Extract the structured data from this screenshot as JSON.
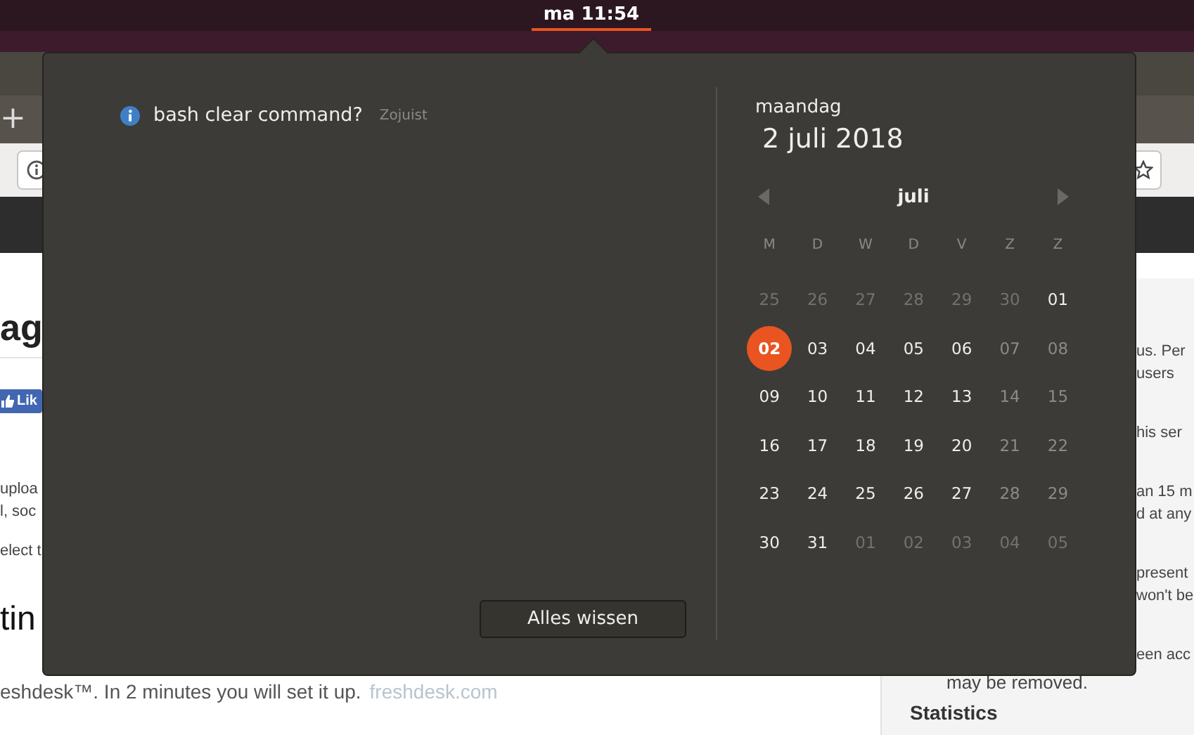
{
  "top_bar": {
    "clock": "ma 11:54"
  },
  "browser": {
    "new_tab": "+"
  },
  "page": {
    "heading": "ag",
    "like_button": "Lik",
    "left_fragments": [
      {
        "lines": [
          "uploa",
          "l, soc"
        ]
      },
      {
        "lines": [
          "elect t"
        ]
      }
    ],
    "section_heading": "tin",
    "footer_text": "eshdesk™. In 2 minutes you will set it up.",
    "footer_link": "freshdesk.com",
    "right_fragments": [
      {
        "lines": [
          "us. Per",
          "users"
        ]
      },
      {
        "lines": [
          "his ser"
        ]
      },
      {
        "lines": [
          "an 15 m",
          "d at any"
        ]
      },
      {
        "lines": [
          "present",
          "won't be"
        ]
      },
      {
        "lines": [
          "een acc"
        ]
      }
    ],
    "list_end": "may be removed.",
    "stats_heading": "Statistics"
  },
  "popup": {
    "notification": {
      "title": "bash clear command?",
      "time": "Zojuist"
    },
    "clear_button": "Alles wissen",
    "calendar": {
      "weekday": "maandag",
      "date": "2 juli 2018",
      "month": "juli",
      "day_headers": [
        "M",
        "D",
        "W",
        "D",
        "V",
        "Z",
        "Z"
      ],
      "weeks": [
        [
          {
            "day": "25",
            "outside_month": true,
            "muted": false,
            "selected": false
          },
          {
            "day": "26",
            "outside_month": true,
            "muted": false,
            "selected": false
          },
          {
            "day": "27",
            "outside_month": true,
            "muted": false,
            "selected": false
          },
          {
            "day": "28",
            "outside_month": true,
            "muted": false,
            "selected": false
          },
          {
            "day": "29",
            "outside_month": true,
            "muted": false,
            "selected": false
          },
          {
            "day": "30",
            "outside_month": true,
            "muted": false,
            "selected": false
          },
          {
            "day": "01",
            "outside_month": false,
            "muted": false,
            "selected": false
          }
        ],
        [
          {
            "day": "02",
            "outside_month": false,
            "muted": false,
            "selected": true
          },
          {
            "day": "03",
            "outside_month": false,
            "muted": false,
            "selected": false
          },
          {
            "day": "04",
            "outside_month": false,
            "muted": false,
            "selected": false
          },
          {
            "day": "05",
            "outside_month": false,
            "muted": false,
            "selected": false
          },
          {
            "day": "06",
            "outside_month": false,
            "muted": false,
            "selected": false
          },
          {
            "day": "07",
            "outside_month": false,
            "muted": true,
            "selected": false
          },
          {
            "day": "08",
            "outside_month": false,
            "muted": true,
            "selected": false
          }
        ],
        [
          {
            "day": "09",
            "outside_month": false,
            "muted": false,
            "selected": false
          },
          {
            "day": "10",
            "outside_month": false,
            "muted": false,
            "selected": false
          },
          {
            "day": "11",
            "outside_month": false,
            "muted": false,
            "selected": false
          },
          {
            "day": "12",
            "outside_month": false,
            "muted": false,
            "selected": false
          },
          {
            "day": "13",
            "outside_month": false,
            "muted": false,
            "selected": false
          },
          {
            "day": "14",
            "outside_month": false,
            "muted": true,
            "selected": false
          },
          {
            "day": "15",
            "outside_month": false,
            "muted": true,
            "selected": false
          }
        ],
        [
          {
            "day": "16",
            "outside_month": false,
            "muted": false,
            "selected": false
          },
          {
            "day": "17",
            "outside_month": false,
            "muted": false,
            "selected": false
          },
          {
            "day": "18",
            "outside_month": false,
            "muted": false,
            "selected": false
          },
          {
            "day": "19",
            "outside_month": false,
            "muted": false,
            "selected": false
          },
          {
            "day": "20",
            "outside_month": false,
            "muted": false,
            "selected": false
          },
          {
            "day": "21",
            "outside_month": false,
            "muted": true,
            "selected": false
          },
          {
            "day": "22",
            "outside_month": false,
            "muted": true,
            "selected": false
          }
        ],
        [
          {
            "day": "23",
            "outside_month": false,
            "muted": false,
            "selected": false
          },
          {
            "day": "24",
            "outside_month": false,
            "muted": false,
            "selected": false
          },
          {
            "day": "25",
            "outside_month": false,
            "muted": false,
            "selected": false
          },
          {
            "day": "26",
            "outside_month": false,
            "muted": false,
            "selected": false
          },
          {
            "day": "27",
            "outside_month": false,
            "muted": false,
            "selected": false
          },
          {
            "day": "28",
            "outside_month": false,
            "muted": true,
            "selected": false
          },
          {
            "day": "29",
            "outside_month": false,
            "muted": true,
            "selected": false
          }
        ],
        [
          {
            "day": "30",
            "outside_month": false,
            "muted": false,
            "selected": false
          },
          {
            "day": "31",
            "outside_month": false,
            "muted": false,
            "selected": false
          },
          {
            "day": "01",
            "outside_month": true,
            "muted": false,
            "selected": false
          },
          {
            "day": "02",
            "outside_month": true,
            "muted": false,
            "selected": false
          },
          {
            "day": "03",
            "outside_month": true,
            "muted": false,
            "selected": false
          },
          {
            "day": "04",
            "outside_month": true,
            "muted": false,
            "selected": false
          },
          {
            "day": "05",
            "outside_month": true,
            "muted": false,
            "selected": false
          }
        ]
      ]
    }
  }
}
